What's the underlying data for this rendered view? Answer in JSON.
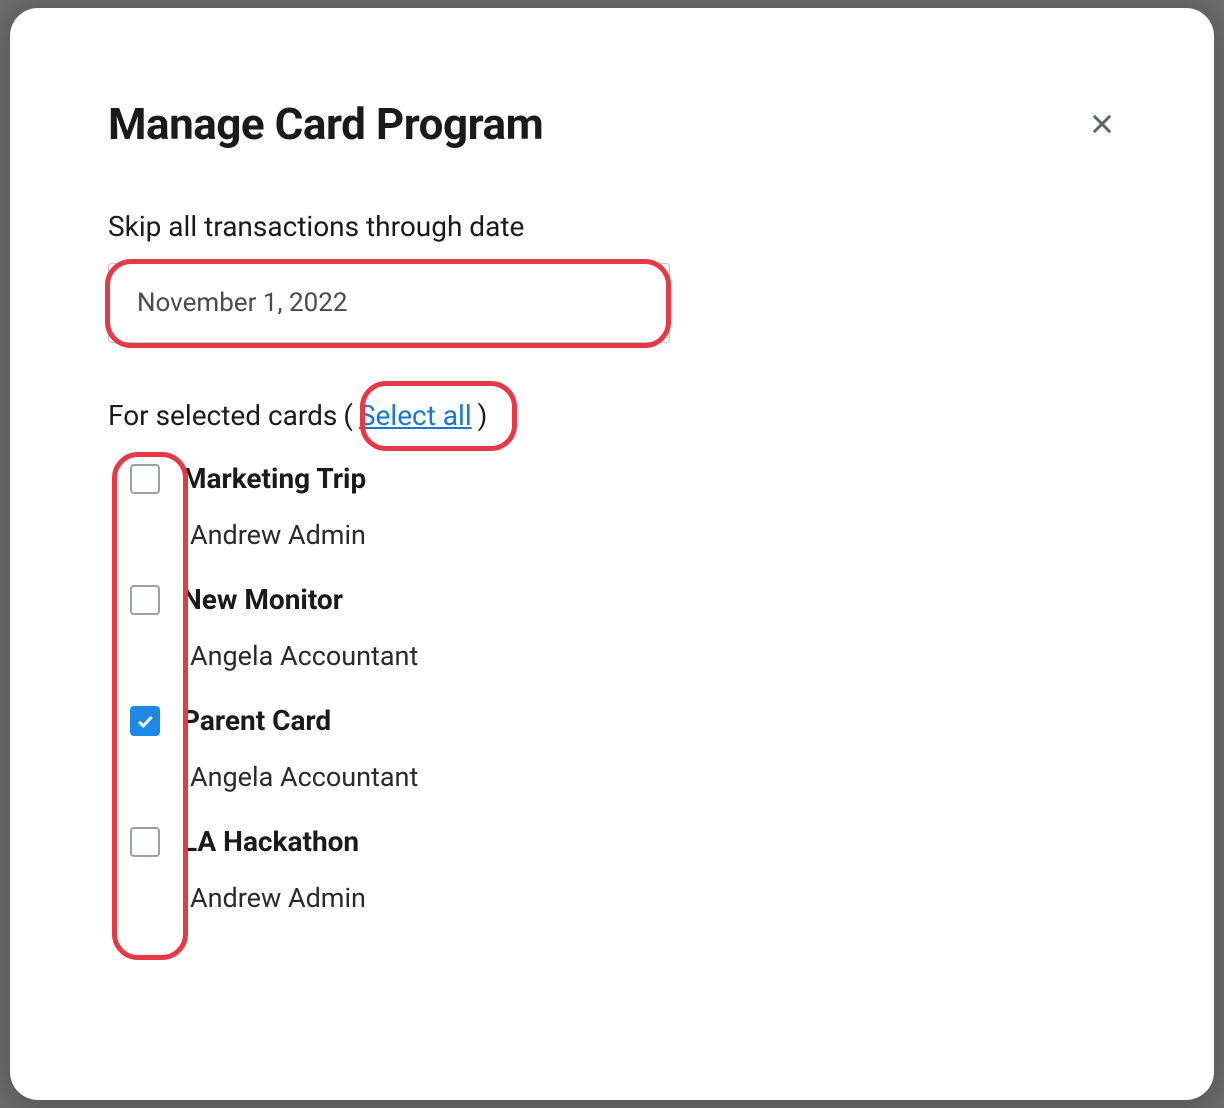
{
  "modal": {
    "title": "Manage Card Program",
    "dateField": {
      "label": "Skip all transactions through date",
      "value": "November 1, 2022"
    },
    "cardsSection": {
      "label": "For selected cards",
      "selectAll": "Select all",
      "openParen": "(",
      "closeParen": ")"
    },
    "cards": [
      {
        "name": "Marketing Trip",
        "owner": "Andrew Admin",
        "checked": false
      },
      {
        "name": "New Monitor",
        "owner": "Angela Accountant",
        "checked": false
      },
      {
        "name": "Parent Card",
        "owner": "Angela Accountant",
        "checked": true
      },
      {
        "name": "LA Hackathon",
        "owner": "Andrew Admin",
        "checked": false
      }
    ]
  }
}
